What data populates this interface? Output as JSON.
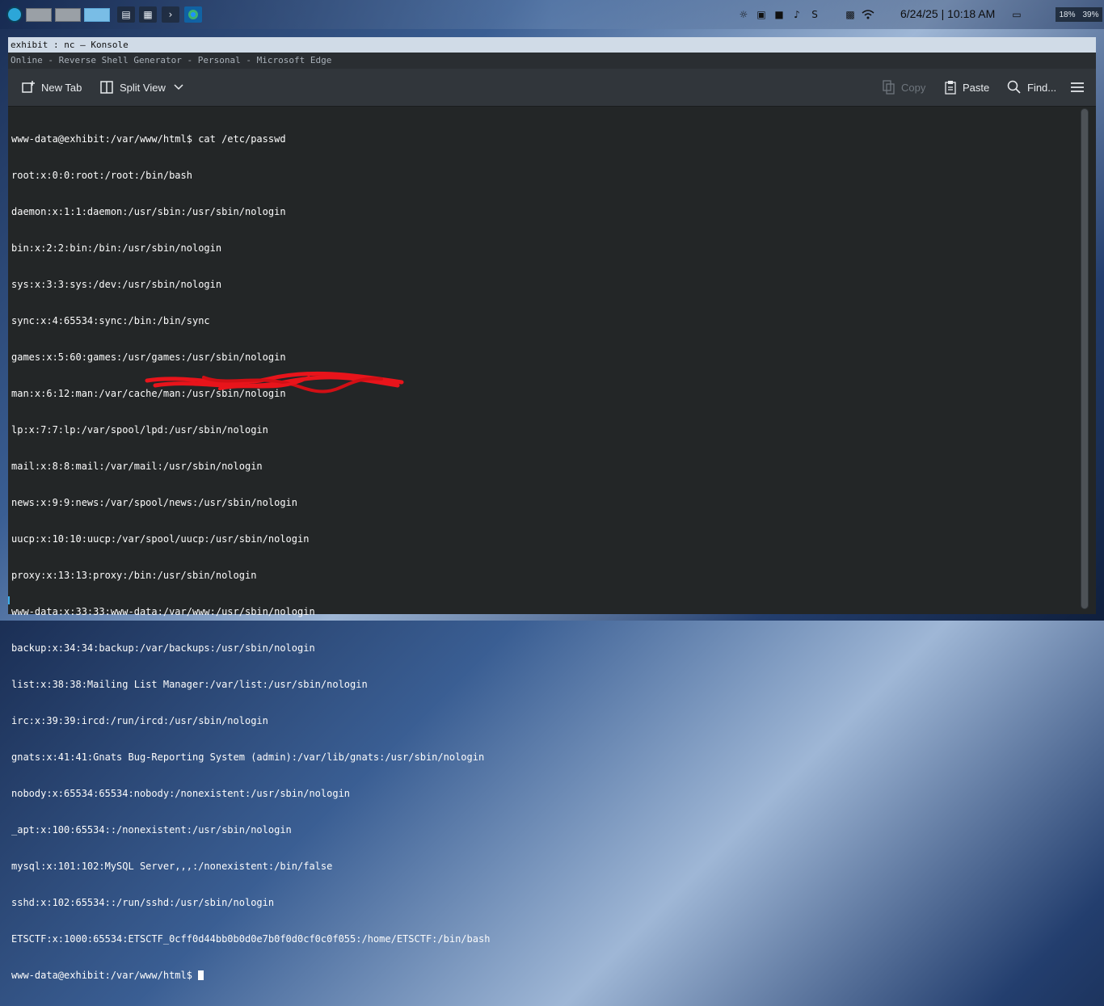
{
  "panel": {
    "launcher_icon": "app-launcher-icon",
    "virtual_desktops": [
      {
        "name": "Desktop 1",
        "active": false
      },
      {
        "name": "Desktop 2",
        "active": false
      },
      {
        "name": "Desktop 3",
        "active": true
      }
    ],
    "taskbar": [
      {
        "icon": "system-monitor-icon"
      },
      {
        "icon": "file-manager-icon"
      },
      {
        "icon": "terminal-icon"
      },
      {
        "icon": "edge-browser-icon"
      }
    ],
    "tray_icons": [
      "notifications-icon",
      "clipboard-icon",
      "media-icon",
      "volume-icon",
      "bluetooth-icon",
      "display-icon",
      "wifi-icon"
    ],
    "clock": "6/24/25 | 10:18 AM",
    "show_desktop_icon": "show-desktop-icon",
    "sysmon": {
      "cpu": "18%",
      "mem": "39%"
    }
  },
  "window": {
    "title": "exhibit : nc — Konsole",
    "subtitle": "Online - Reverse Shell Generator - Personal - Microsoft Edge"
  },
  "toolbar": {
    "new_tab": "New Tab",
    "split_view": "Split View",
    "copy": "Copy",
    "paste": "Paste",
    "find": "Find...",
    "menu_icon": "hamburger-menu-icon"
  },
  "terminal": {
    "lines": [
      "www-data@exhibit:/var/www/html$ cat /etc/passwd",
      "root:x:0:0:root:/root:/bin/bash",
      "daemon:x:1:1:daemon:/usr/sbin:/usr/sbin/nologin",
      "bin:x:2:2:bin:/bin:/usr/sbin/nologin",
      "sys:x:3:3:sys:/dev:/usr/sbin/nologin",
      "sync:x:4:65534:sync:/bin:/bin/sync",
      "games:x:5:60:games:/usr/games:/usr/sbin/nologin",
      "man:x:6:12:man:/var/cache/man:/usr/sbin/nologin",
      "lp:x:7:7:lp:/var/spool/lpd:/usr/sbin/nologin",
      "mail:x:8:8:mail:/var/mail:/usr/sbin/nologin",
      "news:x:9:9:news:/var/spool/news:/usr/sbin/nologin",
      "uucp:x:10:10:uucp:/var/spool/uucp:/usr/sbin/nologin",
      "proxy:x:13:13:proxy:/bin:/usr/sbin/nologin",
      "www-data:x:33:33:www-data:/var/www:/usr/sbin/nologin",
      "backup:x:34:34:backup:/var/backups:/usr/sbin/nologin",
      "list:x:38:38:Mailing List Manager:/var/list:/usr/sbin/nologin",
      "irc:x:39:39:ircd:/run/ircd:/usr/sbin/nologin",
      "gnats:x:41:41:Gnats Bug-Reporting System (admin):/var/lib/gnats:/usr/sbin/nologin",
      "nobody:x:65534:65534:nobody:/nonexistent:/usr/sbin/nologin",
      "_apt:x:100:65534::/nonexistent:/usr/sbin/nologin",
      "mysql:x:101:102:MySQL Server,,,:/nonexistent:/bin/false",
      "sshd:x:102:65534::/run/sshd:/usr/sbin/nologin",
      "ETSCTF:x:1000:65534:ETSCTF_0cff0d44bb0b0d0e7b0f0d0cf0c0f055:/home/ETSCTF:/bin/bash"
    ],
    "prompt": "www-data@exhibit:/var/www/html$ "
  }
}
